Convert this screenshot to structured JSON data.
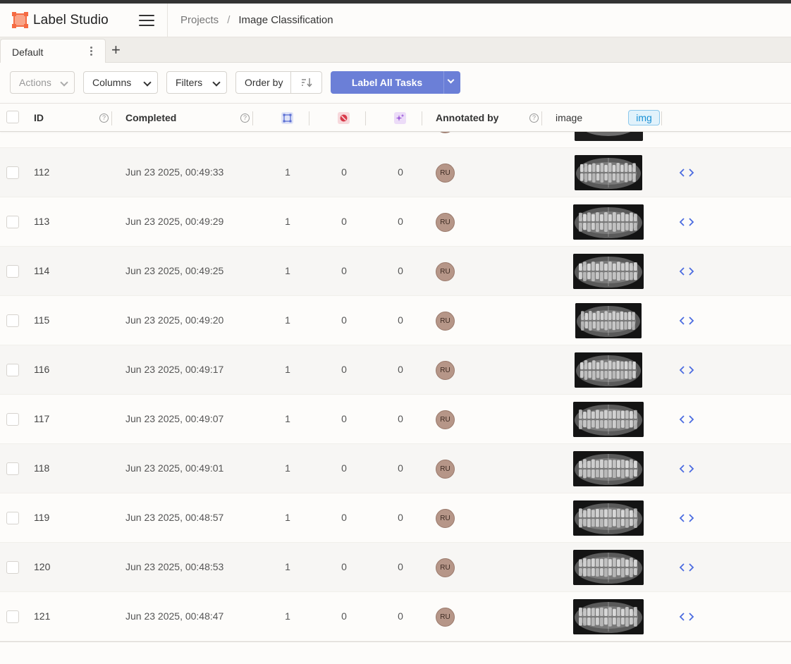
{
  "app": {
    "name": "Label Studio"
  },
  "breadcrumb": {
    "projects": "Projects",
    "separator": "/",
    "current": "Image Classification"
  },
  "tabs": [
    {
      "label": "Default"
    }
  ],
  "toolbar": {
    "actions": "Actions",
    "columns": "Columns",
    "filters": "Filters",
    "order_by": "Order by",
    "label_all": "Label All Tasks"
  },
  "table": {
    "headers": {
      "id": "ID",
      "completed": "Completed",
      "annotated_by": "Annotated by",
      "image": "image",
      "image_badge": "img"
    },
    "icon_columns": [
      {
        "name": "annotations-count-icon",
        "color": "#5b6fd3"
      },
      {
        "name": "cancelled-count-icon",
        "color": "#d83a4a"
      },
      {
        "name": "predictions-count-icon",
        "color": "#9b5ad8"
      }
    ],
    "rows": [
      {
        "id": "112",
        "completed": "Jun 23 2025, 00:49:33",
        "annotations": "1",
        "cancelled": "0",
        "predictions": "0",
        "annotator": "RU"
      },
      {
        "id": "113",
        "completed": "Jun 23 2025, 00:49:29",
        "annotations": "1",
        "cancelled": "0",
        "predictions": "0",
        "annotator": "RU"
      },
      {
        "id": "114",
        "completed": "Jun 23 2025, 00:49:25",
        "annotations": "1",
        "cancelled": "0",
        "predictions": "0",
        "annotator": "RU"
      },
      {
        "id": "115",
        "completed": "Jun 23 2025, 00:49:20",
        "annotations": "1",
        "cancelled": "0",
        "predictions": "0",
        "annotator": "RU"
      },
      {
        "id": "116",
        "completed": "Jun 23 2025, 00:49:17",
        "annotations": "1",
        "cancelled": "0",
        "predictions": "0",
        "annotator": "RU"
      },
      {
        "id": "117",
        "completed": "Jun 23 2025, 00:49:07",
        "annotations": "1",
        "cancelled": "0",
        "predictions": "0",
        "annotator": "RU"
      },
      {
        "id": "118",
        "completed": "Jun 23 2025, 00:49:01",
        "annotations": "1",
        "cancelled": "0",
        "predictions": "0",
        "annotator": "RU"
      },
      {
        "id": "119",
        "completed": "Jun 23 2025, 00:48:57",
        "annotations": "1",
        "cancelled": "0",
        "predictions": "0",
        "annotator": "RU"
      },
      {
        "id": "120",
        "completed": "Jun 23 2025, 00:48:53",
        "annotations": "1",
        "cancelled": "0",
        "predictions": "0",
        "annotator": "RU"
      },
      {
        "id": "121",
        "completed": "Jun 23 2025, 00:48:47",
        "annotations": "1",
        "cancelled": "0",
        "predictions": "0",
        "annotator": "RU"
      }
    ]
  },
  "colors": {
    "brand": "#f56b43",
    "primary_button": "#6b7fd7",
    "img_badge": "#1890d5",
    "avatar": "#b69688",
    "code_icon": "#4a6be0"
  }
}
